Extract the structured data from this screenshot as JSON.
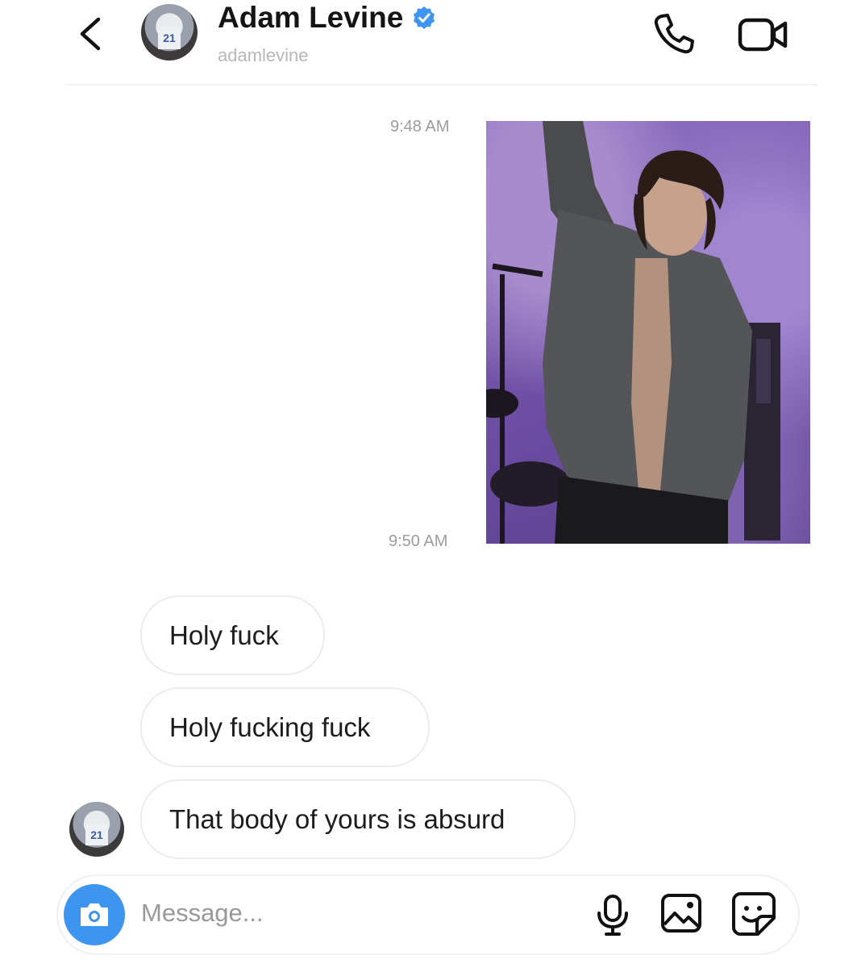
{
  "header": {
    "title": "Adam Levine",
    "subtitle": "adamlevine",
    "avatar_jersey": "21",
    "icons": {
      "back": "chevron-left-icon",
      "verified": "verified-badge-icon",
      "call": "phone-icon",
      "video": "video-camera-icon"
    }
  },
  "messages": {
    "timestamp_1": "9:48 AM",
    "timestamp_2": "9:50 AM",
    "received": [
      "Holy fuck",
      "Holy fucking fuck",
      "That body of yours is absurd"
    ],
    "sender_avatar_jersey": "21"
  },
  "composer": {
    "placeholder": "Message...",
    "icons": {
      "camera": "camera-icon",
      "mic": "microphone-icon",
      "gallery": "image-gallery-icon",
      "sticker": "sticker-icon"
    }
  },
  "colors": {
    "accent_blue": "#3d95ef",
    "verified_blue": "#3d95ef",
    "timestamp_gray": "#9c9c9c",
    "photo_purple": "#8e6fc1"
  }
}
